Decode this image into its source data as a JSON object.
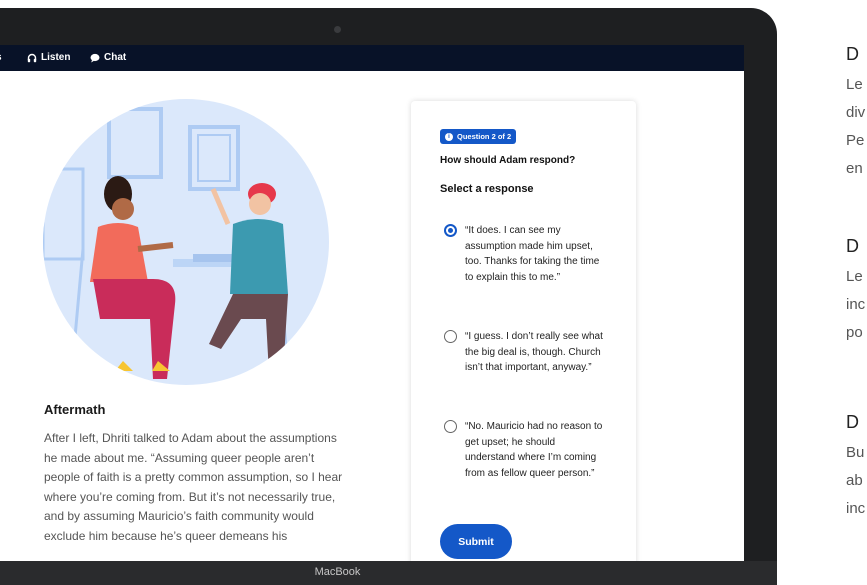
{
  "nav": {
    "items": [
      {
        "label": "s",
        "icon": ""
      },
      {
        "label": "Listen",
        "icon": "headphones-icon"
      },
      {
        "label": "Chat",
        "icon": "chat-bubble-icon"
      }
    ]
  },
  "story": {
    "title": "Aftermath",
    "body": "After I left, Dhriti talked to Adam about the assumptions he made about me. “Assuming queer people aren’t people of faith is a pretty common assumption, so I hear where you’re coming from. But it’s not necessarily true, and by assuming Mauricio’s faith community would exclude him because he’s queer demeans his"
  },
  "question": {
    "badge": "Question 2 of 2",
    "prompt": "How should Adam respond?",
    "instruction": "Select a response",
    "options": [
      {
        "text": "“It does. I can see my assumption made him upset, too. Thanks for taking the time to explain this to me.”",
        "selected": true
      },
      {
        "text": "“I guess. I don’t really see what the big deal is, though. Church isn’t that important, anyway.”",
        "selected": false
      },
      {
        "text": "“No. Mauricio had no reason to get upset; he should understand where I’m coming from as fellow queer person.”",
        "selected": false
      }
    ],
    "submit_label": "Submit"
  },
  "device": {
    "brand": "MacBook"
  },
  "side_panel": {
    "blocks": [
      {
        "heading": "D",
        "lines": [
          "Le",
          "div",
          "Pe",
          "en"
        ]
      },
      {
        "heading": "D",
        "lines": [
          "Le",
          "inc",
          "po"
        ]
      },
      {
        "heading": "D",
        "lines": [
          "Bu",
          "ab",
          "inc"
        ]
      }
    ]
  },
  "colors": {
    "accent": "#1458c8",
    "nav_bg": "#081228",
    "illustration_bg": "#dbe8fb"
  }
}
